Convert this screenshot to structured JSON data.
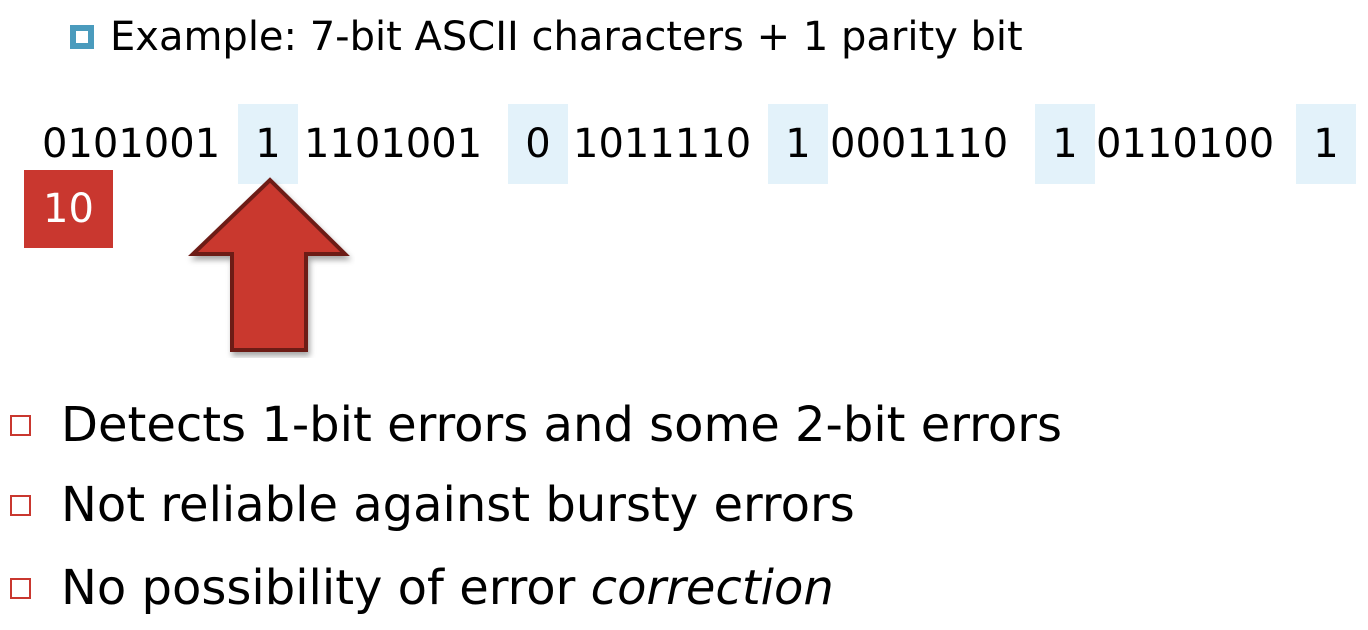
{
  "example": {
    "icon": "square-bullet-icon",
    "text": "Example: 7-bit ASCII characters + 1 parity bit"
  },
  "bits": {
    "groups": [
      "0101001",
      "1101001",
      "1011110",
      "0001110",
      "0110100"
    ],
    "parity": [
      "1",
      "0",
      "1",
      "1",
      "1"
    ]
  },
  "slide_number": "10",
  "arrow": {
    "icon": "up-arrow-icon",
    "color": "#c9372f"
  },
  "colors": {
    "accent": "#c9372f",
    "highlight": "#e3f2fa",
    "bullet_blue": "#4a9bbd"
  },
  "bullets": [
    {
      "text": "Detects 1-bit errors and some 2-bit errors"
    },
    {
      "text": "Not reliable against bursty errors"
    },
    {
      "text_prefix": "No possibility of error ",
      "text_emphasis": "correction"
    }
  ]
}
